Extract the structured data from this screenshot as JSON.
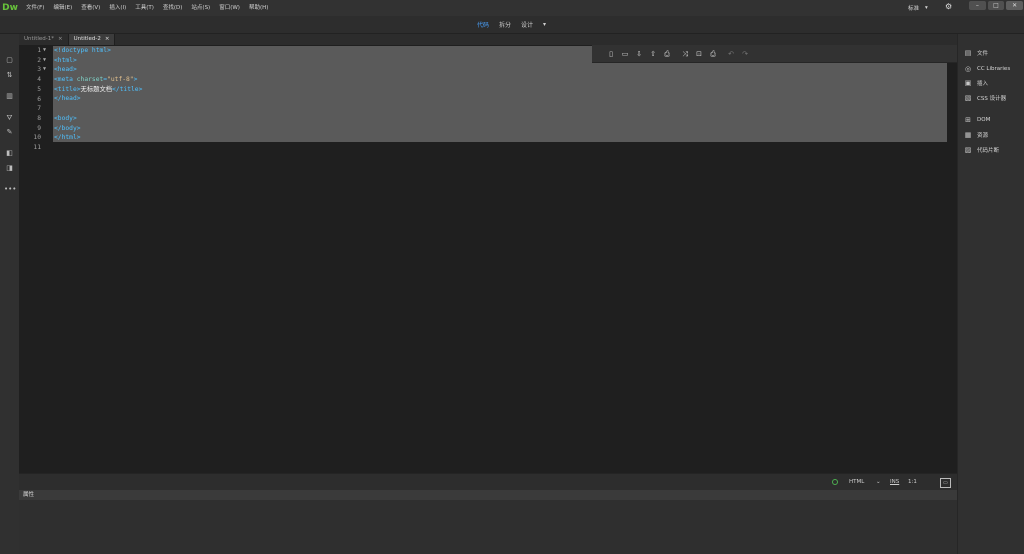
{
  "app": {
    "logo": "Dw"
  },
  "menu": [
    "文件(F)",
    "编辑(E)",
    "查看(V)",
    "插入(I)",
    "工具(T)",
    "查找(D)",
    "站点(S)",
    "窗口(W)",
    "帮助(H)"
  ],
  "workspace": {
    "label": "标准",
    "caret": "▾"
  },
  "views": {
    "code": "代码",
    "split": "拆分",
    "design": "设计",
    "dropdown": "▾"
  },
  "tabs": [
    {
      "label": "Untitled-1*",
      "close": "×"
    },
    {
      "label": "Untitled-2",
      "close": "×"
    }
  ],
  "editor": {
    "lines": [
      "1",
      "2",
      "3",
      "4",
      "5",
      "6",
      "7",
      "8",
      "9",
      "10",
      "11"
    ],
    "code": [
      [
        {
          "c": "t-tag",
          "v": "<!doctype html>"
        }
      ],
      [
        {
          "c": "t-tag",
          "v": "<html>"
        }
      ],
      [
        {
          "c": "t-tag",
          "v": "<head>"
        }
      ],
      [
        {
          "c": "t-tag",
          "v": "<meta "
        },
        {
          "c": "t-attr",
          "v": "charset"
        },
        {
          "c": "t-tag",
          "v": "="
        },
        {
          "c": "t-str",
          "v": "\"utf-8\""
        },
        {
          "c": "t-tag",
          "v": ">"
        }
      ],
      [
        {
          "c": "t-tag",
          "v": "<title>"
        },
        {
          "c": "t-txt",
          "v": "无标题文档"
        },
        {
          "c": "t-tag",
          "v": "</title>"
        }
      ],
      [
        {
          "c": "t-tag",
          "v": "</head>"
        }
      ],
      [],
      [
        {
          "c": "t-tag",
          "v": "<body>"
        }
      ],
      [
        {
          "c": "t-tag",
          "v": "</body>"
        }
      ],
      [
        {
          "c": "t-tag",
          "v": "</html>"
        }
      ],
      []
    ]
  },
  "right_panel": [
    {
      "label": "文件",
      "icon": "folder-icon"
    },
    {
      "label": "CC Libraries",
      "icon": "cc-libraries-icon"
    },
    {
      "label": "插入",
      "icon": "insert-icon"
    },
    {
      "label": "CSS 设计器",
      "icon": "css-designer-icon"
    },
    {
      "label": "DOM",
      "icon": "dom-icon"
    },
    {
      "label": "资源",
      "icon": "assets-icon"
    },
    {
      "label": "代码片断",
      "icon": "snippets-icon"
    }
  ],
  "status": {
    "language": "HTML",
    "mode": "INS",
    "position": "1:1"
  },
  "properties": {
    "title": "属性"
  }
}
